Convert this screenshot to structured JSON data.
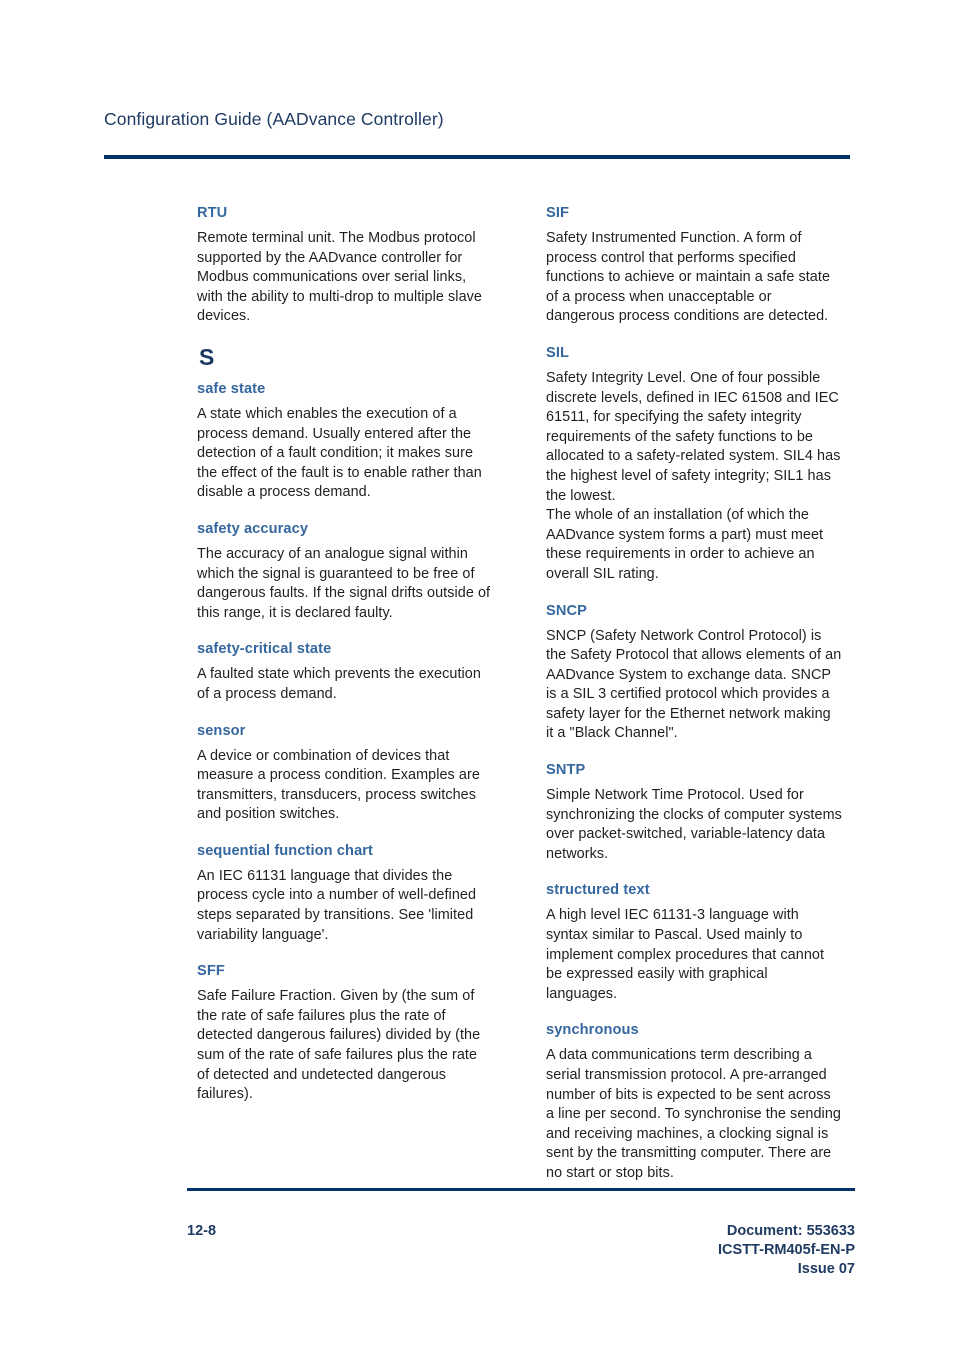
{
  "header": {
    "title": "Configuration Guide (AADvance Controller)",
    "rule_color": "#013366",
    "title_color": "#1f3a63"
  },
  "theme": {
    "term_color": "#35679f",
    "letter_heading_color": "#1b3a63",
    "body_text_color": "#231f20",
    "rule_color": "#013366",
    "page_background": "#ffffff"
  },
  "columns": {
    "left": {
      "entries": [
        {
          "term": "RTU",
          "definition": "Remote terminal unit. The Modbus protocol supported by the AADvance controller for Modbus communications over serial links, with the ability to multi-drop to multiple slave devices."
        },
        {
          "letter_heading": "S"
        },
        {
          "term": "safe state",
          "definition": "A state which enables the execution of a process demand. Usually entered after the detection of a fault condition; it makes sure the effect of the fault is to enable rather than disable a process demand."
        },
        {
          "term": "safety accuracy",
          "definition": "The accuracy of an analogue signal within which the signal is guaranteed to be free of dangerous faults. If the signal drifts outside of this range, it is declared faulty."
        },
        {
          "term": "safety-critical state",
          "definition": "A faulted state which prevents the execution of a process demand."
        },
        {
          "term": "sensor",
          "definition": "A device or combination of devices that measure a process condition. Examples are transmitters, transducers, process switches and position switches."
        },
        {
          "term": "sequential function chart",
          "definition": "An IEC 61131 language that divides the process cycle into a number of well-defined steps separated by transitions. See 'limited variability language'."
        },
        {
          "term": "SFF",
          "definition": "Safe Failure Fraction. Given by (the sum of the rate of safe failures plus the rate of detected dangerous failures) divided by (the sum of the rate of safe failures plus the rate of detected and undetected dangerous failures)."
        }
      ]
    },
    "right": {
      "entries": [
        {
          "term": "SIF",
          "definition": "Safety Instrumented Function. A form of process control that performs specified functions to achieve or maintain a safe state of a process when unacceptable or dangerous process conditions are detected."
        },
        {
          "term": "SIL",
          "definition": "Safety Integrity Level. One of four possible discrete levels, defined in IEC 61508 and IEC 61511, for specifying the safety integrity requirements of the safety functions to be allocated to a safety-related system. SIL4 has the highest level of safety integrity; SIL1 has the lowest.",
          "definition2": "The whole of an installation (of which the AADvance system forms a part) must meet these requirements in order to achieve an overall SIL rating."
        },
        {
          "term": "SNCP",
          "definition": "SNCP (Safety Network Control Protocol) is the Safety Protocol that allows elements of an AADvance System to exchange data. SNCP is a SIL 3 certified protocol which provides a safety layer for the Ethernet network making it a \"Black Channel\"."
        },
        {
          "term": "SNTP",
          "definition": "Simple Network Time Protocol. Used for synchronizing the clocks of computer systems over packet-switched, variable-latency data networks."
        },
        {
          "term": "structured text",
          "definition": "A high level IEC 61131-3 language with syntax similar to Pascal. Used mainly to implement complex procedures that cannot be expressed easily with graphical languages."
        },
        {
          "term": "synchronous",
          "definition": "A data communications term describing a serial transmission protocol. A pre-arranged number of bits is expected to be sent across a line per second. To synchronise the sending and receiving machines, a clocking signal is sent by the transmitting computer. There are no start or stop bits."
        }
      ]
    }
  },
  "footer": {
    "page_number": "12-8",
    "document_line": "Document: 553633",
    "document_code": "ICSTT-RM405f-EN-P",
    "issue": "Issue 07"
  }
}
